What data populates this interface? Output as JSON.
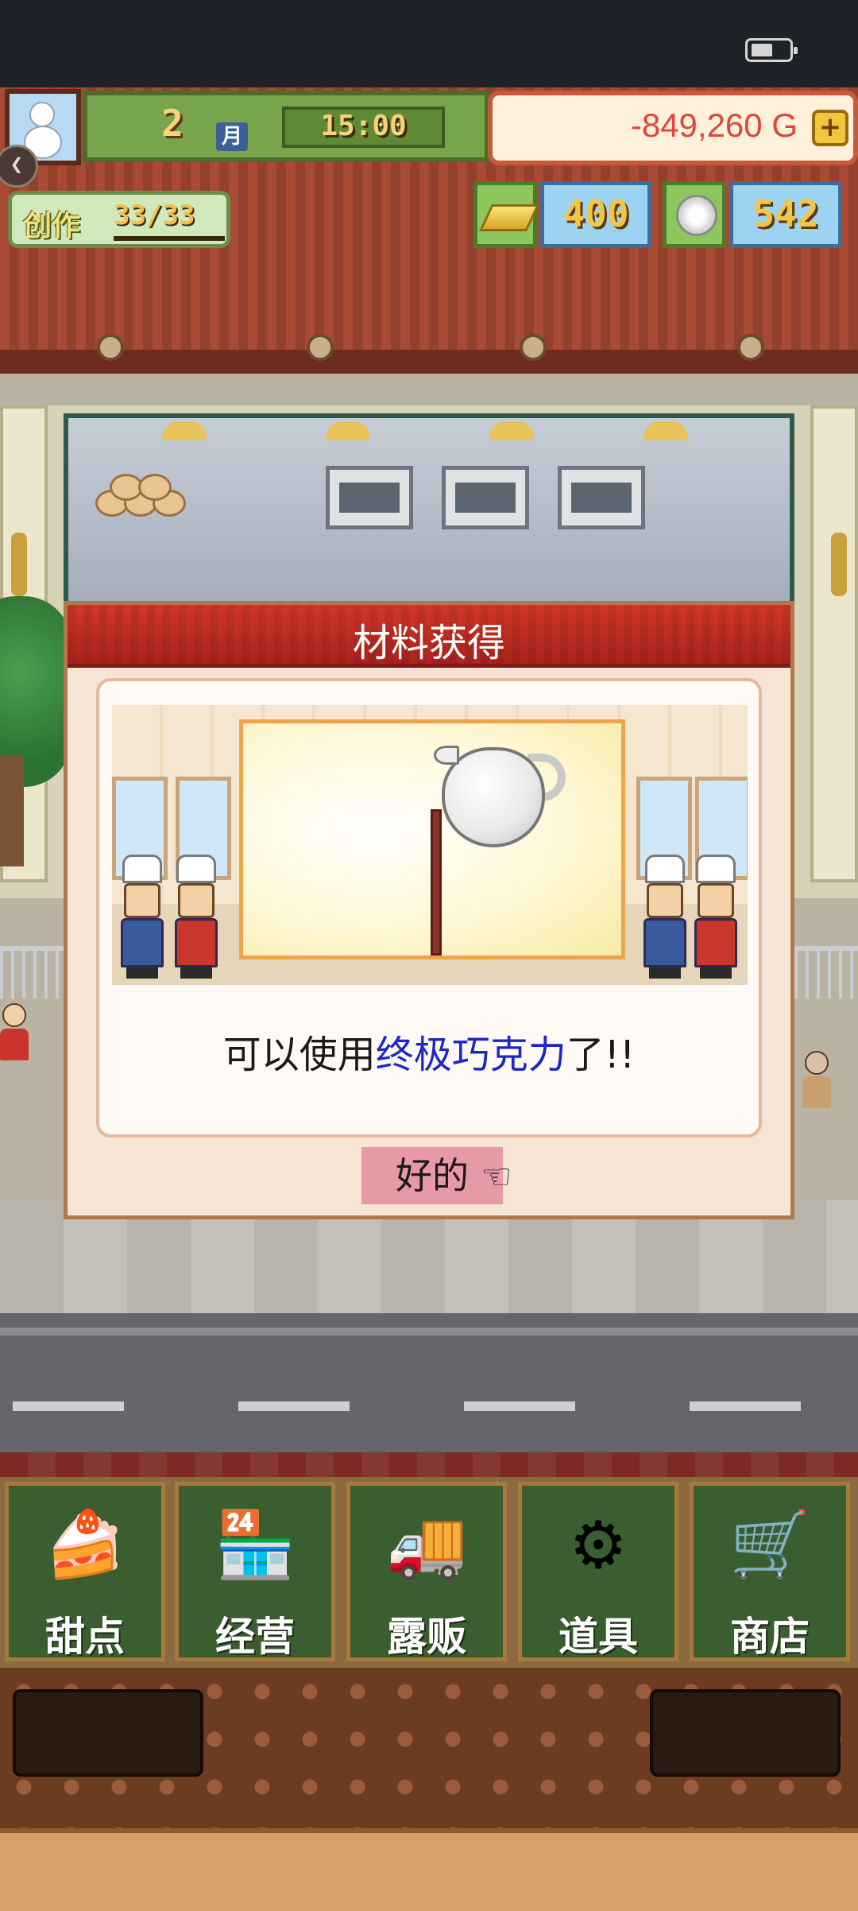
{
  "hud": {
    "month": "2",
    "month_label": "月",
    "time": "15:00",
    "money": "-849,260 G",
    "add_money_label": "+",
    "create_label": "创作",
    "create_count": "33/33",
    "gold_count": "400",
    "plate_count": "542"
  },
  "dialog": {
    "title": "材料获得",
    "message_prefix": "可以使用",
    "message_highlight": "终极巧克力",
    "message_suffix": "了!!",
    "ok_label": "好的"
  },
  "menu": [
    {
      "label": "甜点",
      "icon": "cake-icon"
    },
    {
      "label": "经营",
      "icon": "shop-icon"
    },
    {
      "label": "露贩",
      "icon": "food-truck-icon"
    },
    {
      "label": "道具",
      "icon": "items-bag-icon"
    },
    {
      "label": "商店",
      "icon": "shopping-cart-icon"
    }
  ],
  "colors": {
    "money_negative": "#e0453b",
    "highlight_text": "#1f26c8",
    "dialog_header": "#c02d22",
    "ok_button": "#e79aa5",
    "menu_button": "#3b5e30"
  }
}
